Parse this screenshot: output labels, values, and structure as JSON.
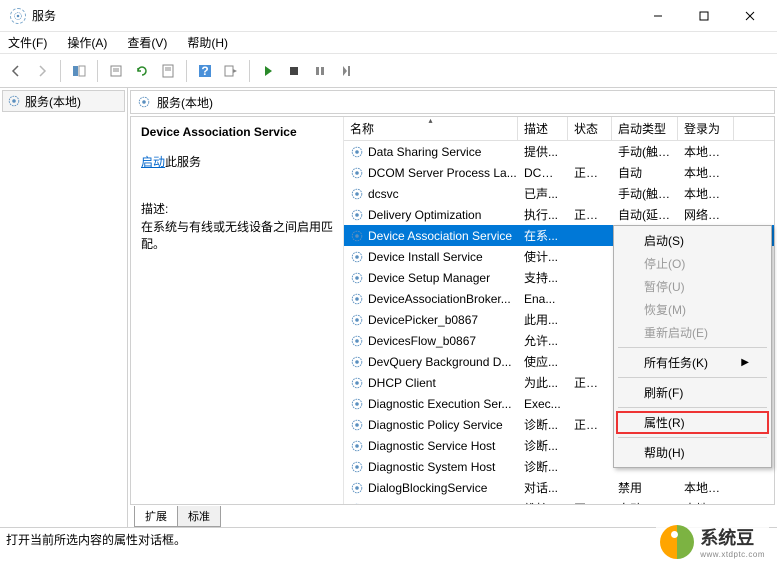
{
  "window": {
    "title": "服务"
  },
  "menu": {
    "file": "文件(F)",
    "action": "操作(A)",
    "view": "查看(V)",
    "help": "帮助(H)"
  },
  "tree": {
    "root": "服务(本地)"
  },
  "panel": {
    "heading": "服务(本地)"
  },
  "info": {
    "selected_name": "Device Association Service",
    "start_link": "启动",
    "start_suffix": "此服务",
    "desc_label": "描述:",
    "desc": "在系统与有线或无线设备之间启用匹配。"
  },
  "columns": {
    "name": "名称",
    "desc": "描述",
    "status": "状态",
    "startup": "启动类型",
    "logon": "登录为"
  },
  "rows": [
    {
      "name": "Data Sharing Service",
      "desc": "提供...",
      "status": "",
      "startup": "手动(触发...",
      "logon": "本地系统"
    },
    {
      "name": "DCOM Server Process La...",
      "desc": "DCOM...",
      "status": "正在...",
      "startup": "自动",
      "logon": "本地系统"
    },
    {
      "name": "dcsvc",
      "desc": "已声...",
      "status": "",
      "startup": "手动(触发...",
      "logon": "本地系统"
    },
    {
      "name": "Delivery Optimization",
      "desc": "执行...",
      "status": "正在...",
      "startup": "自动(延迟...",
      "logon": "网络服务"
    },
    {
      "name": "Device Association Service",
      "desc": "在系...",
      "status": "",
      "startup": "",
      "logon": ""
    },
    {
      "name": "Device Install Service",
      "desc": "使计...",
      "status": "",
      "startup": "",
      "logon": ""
    },
    {
      "name": "Device Setup Manager",
      "desc": "支持...",
      "status": "",
      "startup": "",
      "logon": ""
    },
    {
      "name": "DeviceAssociationBroker...",
      "desc": "Ena...",
      "status": "",
      "startup": "",
      "logon": ""
    },
    {
      "name": "DevicePicker_b0867",
      "desc": "此用...",
      "status": "",
      "startup": "",
      "logon": ""
    },
    {
      "name": "DevicesFlow_b0867",
      "desc": "允许...",
      "status": "",
      "startup": "",
      "logon": ""
    },
    {
      "name": "DevQuery Background D...",
      "desc": "使应...",
      "status": "",
      "startup": "",
      "logon": ""
    },
    {
      "name": "DHCP Client",
      "desc": "为此...",
      "status": "正在...",
      "startup": "",
      "logon": ""
    },
    {
      "name": "Diagnostic Execution Ser...",
      "desc": "Exec...",
      "status": "",
      "startup": "",
      "logon": ""
    },
    {
      "name": "Diagnostic Policy Service",
      "desc": "诊断...",
      "status": "正在...",
      "startup": "",
      "logon": ""
    },
    {
      "name": "Diagnostic Service Host",
      "desc": "诊断...",
      "status": "",
      "startup": "",
      "logon": ""
    },
    {
      "name": "Diagnostic System Host",
      "desc": "诊断...",
      "status": "",
      "startup": "",
      "logon": ""
    },
    {
      "name": "DialogBlockingService",
      "desc": "对话...",
      "status": "",
      "startup": "禁用",
      "logon": "本地系统"
    },
    {
      "name": "Distributed Link Tracking...",
      "desc": "维护...",
      "status": "正在...",
      "startup": "自动",
      "logon": "本地系统"
    }
  ],
  "selected_index": 4,
  "tabs": {
    "extended": "扩展",
    "standard": "标准"
  },
  "statusbar": "打开当前所选内容的属性对话框。",
  "context": {
    "start": "启动(S)",
    "stop": "停止(O)",
    "pause": "暂停(U)",
    "resume": "恢复(M)",
    "restart": "重新启动(E)",
    "all_tasks": "所有任务(K)",
    "refresh": "刷新(F)",
    "properties": "属性(R)",
    "help": "帮助(H)"
  },
  "logo": {
    "cn": "系统豆",
    "en": "www.xtdptc.com"
  }
}
